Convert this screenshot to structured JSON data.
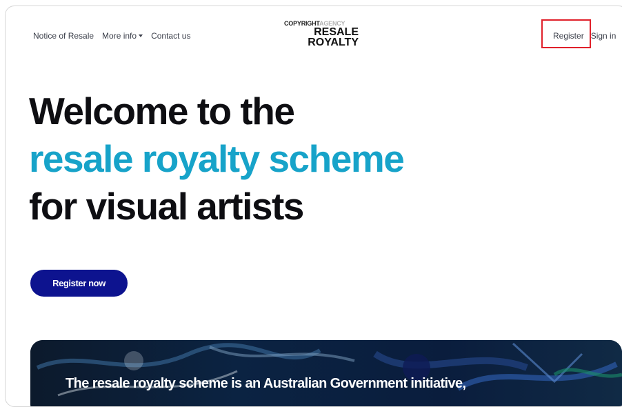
{
  "nav": {
    "links": [
      {
        "label": "Notice of Resale"
      },
      {
        "label": "More info"
      },
      {
        "label": "Contact us"
      }
    ],
    "register_label": "Register",
    "signin_label": "Sign in"
  },
  "logo": {
    "copyright": "COPYRIGHT",
    "agency": "AGENCY",
    "line1": "RESALE",
    "line2": "ROYALTY"
  },
  "hero": {
    "line1": "Welcome to the",
    "line2": "resale royalty scheme",
    "line3": "for visual artists",
    "cta_label": "Register now"
  },
  "banner": {
    "text": "The resale royalty scheme is an Australian Government initiative,"
  },
  "colors": {
    "accent": "#17a3c9",
    "cta_bg": "#0d138f",
    "highlight": "#e0202a"
  }
}
